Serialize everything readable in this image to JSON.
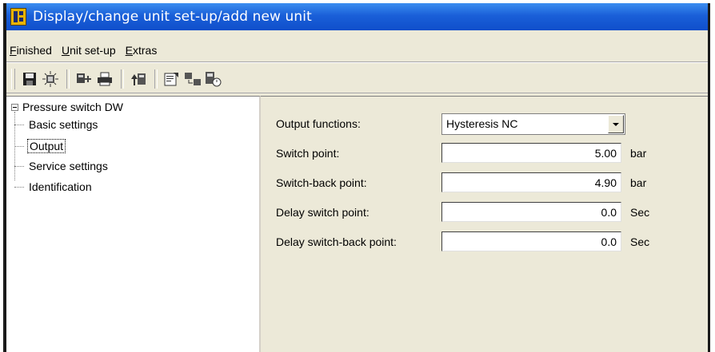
{
  "window": {
    "title": "Display/change unit set-up/add new unit"
  },
  "menubar": {
    "items": [
      {
        "label": "Finished"
      },
      {
        "label": "Unit set-up"
      },
      {
        "label": "Extras"
      }
    ]
  },
  "toolbar": {
    "buttons": [
      "save-icon",
      "unit-scan-icon",
      "device-settings-icon",
      "print-icon",
      "upload-icon",
      "properties-icon",
      "connect-icon",
      "device-status-icon"
    ]
  },
  "tree": {
    "root": "Pressure switch DW",
    "children": [
      {
        "label": "Basic settings"
      },
      {
        "label": "Output",
        "selected": true
      },
      {
        "label": "Service settings"
      },
      {
        "label": "Identification"
      }
    ]
  },
  "form": {
    "output_functions": {
      "label": "Output functions:",
      "value": "Hysteresis NC"
    },
    "switch_point": {
      "label": "Switch point:",
      "value": "5.00",
      "unit": "bar"
    },
    "switch_back_point": {
      "label": "Switch-back point:",
      "value": "4.90",
      "unit": "bar"
    },
    "delay_switch_point": {
      "label": "Delay switch point:",
      "value": "0.0",
      "unit": "Sec"
    },
    "delay_switch_back_point": {
      "label": "Delay switch-back point:",
      "value": "0.0",
      "unit": "Sec"
    }
  },
  "colors": {
    "titlebar": "#1a5fd8",
    "panel": "#ece9d8"
  }
}
